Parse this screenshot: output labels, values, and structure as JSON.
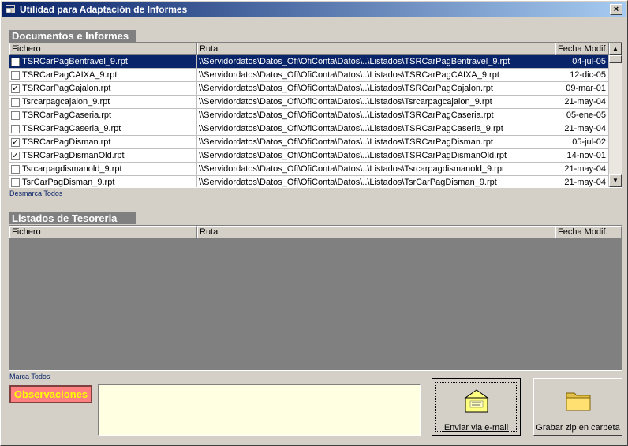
{
  "window": {
    "title": "Utilidad para Adaptación de Informes",
    "close_label": "×"
  },
  "documentos": {
    "section_label": "Documentos e Informes",
    "headers": {
      "file": "Fichero",
      "path": "Ruta",
      "date": "Fecha Modif."
    },
    "rows": [
      {
        "checked": false,
        "file": "TSRCarPagBentravel_9.rpt",
        "path": "\\\\Servidordatos\\Datos_Ofi\\OfiConta\\Datos\\..\\Listados\\TSRCarPagBentravel_9.rpt",
        "date": "04-jul-05",
        "selected": true
      },
      {
        "checked": false,
        "file": "TSRCarPagCAIXA_9.rpt",
        "path": "\\\\Servidordatos\\Datos_Ofi\\OfiConta\\Datos\\..\\Listados\\TSRCarPagCAIXA_9.rpt",
        "date": "12-dic-05",
        "selected": false
      },
      {
        "checked": true,
        "file": "TSRCarPagCajalon.rpt",
        "path": "\\\\Servidordatos\\Datos_Ofi\\OfiConta\\Datos\\..\\Listados\\TSRCarPagCajalon.rpt",
        "date": "09-mar-01",
        "selected": false
      },
      {
        "checked": false,
        "file": "Tsrcarpagcajalon_9.rpt",
        "path": "\\\\Servidordatos\\Datos_Ofi\\OfiConta\\Datos\\..\\Listados\\Tsrcarpagcajalon_9.rpt",
        "date": "21-may-04",
        "selected": false
      },
      {
        "checked": false,
        "file": "TSRCarPagCaseria.rpt",
        "path": "\\\\Servidordatos\\Datos_Ofi\\OfiConta\\Datos\\..\\Listados\\TSRCarPagCaseria.rpt",
        "date": "05-ene-05",
        "selected": false
      },
      {
        "checked": false,
        "file": "TSRCarPagCaseria_9.rpt",
        "path": "\\\\Servidordatos\\Datos_Ofi\\OfiConta\\Datos\\..\\Listados\\TSRCarPagCaseria_9.rpt",
        "date": "21-may-04",
        "selected": false
      },
      {
        "checked": true,
        "file": "TSRCarPagDisman.rpt",
        "path": "\\\\Servidordatos\\Datos_Ofi\\OfiConta\\Datos\\..\\Listados\\TSRCarPagDisman.rpt",
        "date": "05-jul-02",
        "selected": false
      },
      {
        "checked": true,
        "file": "TSRCarPagDismanOld.rpt",
        "path": "\\\\Servidordatos\\Datos_Ofi\\OfiConta\\Datos\\..\\Listados\\TSRCarPagDismanOld.rpt",
        "date": "14-nov-01",
        "selected": false
      },
      {
        "checked": false,
        "file": "Tsrcarpagdismanold_9.rpt",
        "path": "\\\\Servidordatos\\Datos_Ofi\\OfiConta\\Datos\\..\\Listados\\Tsrcarpagdismanold_9.rpt",
        "date": "21-may-04",
        "selected": false
      },
      {
        "checked": false,
        "file": "TsrCarPagDisman_9.rpt",
        "path": "\\\\Servidordatos\\Datos_Ofi\\OfiConta\\Datos\\..\\Listados\\TsrCarPagDisman_9.rpt",
        "date": "21-may-04",
        "selected": false
      }
    ],
    "unmark_all": "Desmarca Todos"
  },
  "tesoreria": {
    "section_label": "Listados de Tesoreria",
    "headers": {
      "file": "Fichero",
      "path": "Ruta",
      "date": "Fecha Modif."
    },
    "mark_all": "Marca Todos"
  },
  "footer": {
    "observations_label": "Observaciones",
    "observations_value": "",
    "send_email_label": "Enviar via e-mail",
    "save_zip_label": "Grabar zip en carpeta"
  },
  "icons": {
    "app": "app-icon",
    "envelope": "envelope-icon",
    "folder": "folder-icon",
    "scroll_up": "scroll-up-icon",
    "scroll_down": "scroll-down-icon"
  },
  "colors": {
    "selection": "#0a246a",
    "observations_bg": "#ff8080",
    "observations_text": "#ffff00",
    "empty_grid": "#808080",
    "note_bg": "#ffffe1"
  }
}
